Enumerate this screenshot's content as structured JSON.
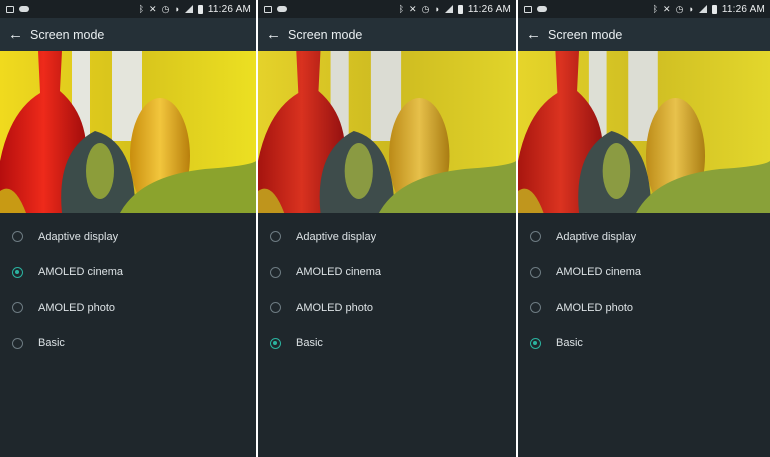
{
  "screens": [
    {
      "status": {
        "time": "11:26 AM"
      },
      "app_bar": {
        "title": "Screen mode"
      },
      "options": [
        {
          "label": "Adaptive display",
          "selected": false
        },
        {
          "label": "AMOLED cinema",
          "selected": true
        },
        {
          "label": "AMOLED photo",
          "selected": false
        },
        {
          "label": "Basic",
          "selected": false
        }
      ]
    },
    {
      "status": {
        "time": "11:26 AM"
      },
      "app_bar": {
        "title": "Screen mode"
      },
      "options": [
        {
          "label": "Adaptive display",
          "selected": false
        },
        {
          "label": "AMOLED cinema",
          "selected": false
        },
        {
          "label": "AMOLED photo",
          "selected": false
        },
        {
          "label": "Basic",
          "selected": true
        }
      ]
    },
    {
      "status": {
        "time": "11:26 AM"
      },
      "app_bar": {
        "title": "Screen mode"
      },
      "options": [
        {
          "label": "Adaptive display",
          "selected": false
        },
        {
          "label": "AMOLED cinema",
          "selected": false
        },
        {
          "label": "AMOLED photo",
          "selected": false
        },
        {
          "label": "Basic",
          "selected": true
        }
      ]
    }
  ],
  "icons": {
    "back": "back-arrow-icon",
    "radio": "radio-button-icon",
    "status_left": [
      "image-icon",
      "cloud-icon"
    ],
    "status_right": [
      "bluetooth-icon",
      "mute-icon",
      "alarm-icon",
      "wifi-icon",
      "signal-icon",
      "battery-icon"
    ]
  },
  "colors": {
    "background": "#1f272c",
    "app_bar": "#253037",
    "accent": "#2bb3a0",
    "text": "#dce2e5"
  }
}
